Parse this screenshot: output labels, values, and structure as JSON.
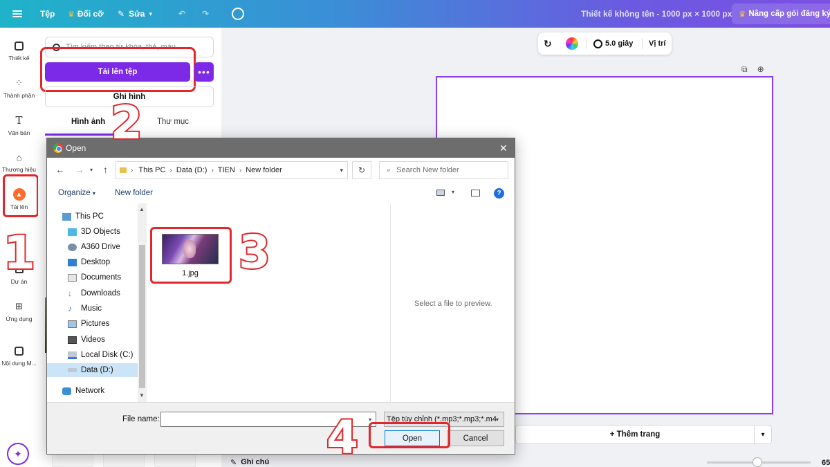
{
  "topbar": {
    "file": "Tệp",
    "resize": "Đổi cỡ",
    "edit": "Sửa",
    "design_title": "Thiết kế không tên - 1000 px × 1000 px",
    "upgrade": "Nâng cấp gói đăng ký"
  },
  "rail": {
    "items": [
      {
        "label": "Thiết kế",
        "icon": "layout-icon"
      },
      {
        "label": "Thành phần",
        "icon": "elements-icon"
      },
      {
        "label": "Văn bản",
        "icon": "text-icon"
      },
      {
        "label": "Thương hiệu",
        "icon": "brand-icon"
      },
      {
        "label": "Tải lên",
        "icon": "upload-cloud-icon"
      },
      {
        "label": "Dự án",
        "icon": "projects-icon"
      },
      {
        "label": "Ứng dụng",
        "icon": "apps-icon"
      },
      {
        "label": "Nội dung M...",
        "icon": "magic-media-icon"
      }
    ]
  },
  "panel": {
    "search_placeholder": "Tìm kiếm theo từ khóa, thẻ, màu",
    "upload_button": "Tải lên tệp",
    "record_button": "Ghi hình",
    "tabs": [
      "Hình ảnh",
      "Thư mục"
    ]
  },
  "canvas_toolbar": {
    "duration": "5.0 giây",
    "position": "Vị trí"
  },
  "canvas": {
    "add_page": "+ Thêm trang",
    "notes": "Ghi chú",
    "zoom": "65"
  },
  "dialog": {
    "title": "Open",
    "breadcrumbs": [
      "This PC",
      "Data (D:)",
      "TIEN",
      "New folder"
    ],
    "search_placeholder": "Search New folder",
    "organize": "Organize",
    "new_folder": "New folder",
    "nav_items": [
      {
        "label": "This PC",
        "icon": "pc-icon"
      },
      {
        "label": "3D Objects",
        "icon": "cube-icon"
      },
      {
        "label": "A360 Drive",
        "icon": "drive-icon"
      },
      {
        "label": "Desktop",
        "icon": "desktop-icon"
      },
      {
        "label": "Documents",
        "icon": "document-icon"
      },
      {
        "label": "Downloads",
        "icon": "download-icon"
      },
      {
        "label": "Music",
        "icon": "music-icon"
      },
      {
        "label": "Pictures",
        "icon": "pictures-icon"
      },
      {
        "label": "Videos",
        "icon": "video-icon"
      },
      {
        "label": "Local Disk (C:)",
        "icon": "disk-icon"
      },
      {
        "label": "Data (D:)",
        "icon": "disk-icon"
      },
      {
        "label": "Network",
        "icon": "network-icon"
      }
    ],
    "file_name": "1.jpg",
    "preview_message": "Select a file to preview.",
    "file_name_label": "File name:",
    "file_name_value": "",
    "filter": "Tệp tùy chỉnh (*.mp3;*.mp3;*.m4",
    "open_button": "Open",
    "cancel_button": "Cancel"
  },
  "steps": [
    "1",
    "2",
    "3",
    "4"
  ]
}
